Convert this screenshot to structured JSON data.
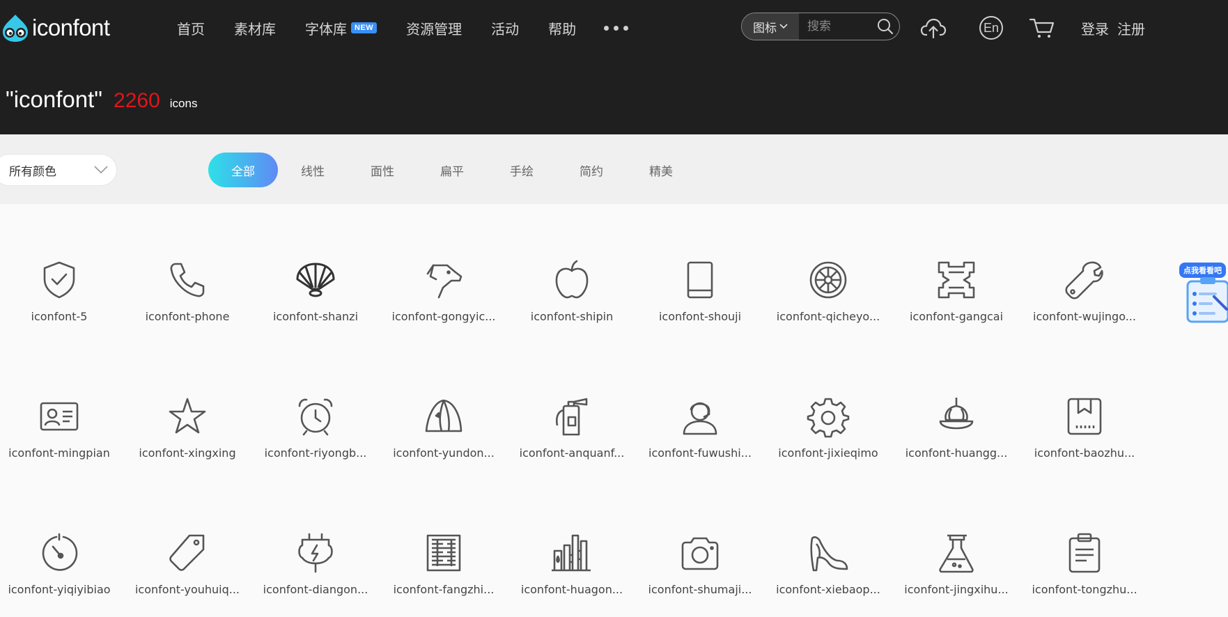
{
  "header": {
    "logo_text": "iconfont",
    "nav": [
      {
        "label": "首页"
      },
      {
        "label": "素材库"
      },
      {
        "label": "字体库",
        "badge": "NEW"
      },
      {
        "label": "资源管理"
      },
      {
        "label": "活动"
      },
      {
        "label": "帮助"
      }
    ],
    "search": {
      "type_label": "图标",
      "placeholder": "搜索"
    },
    "lang_label": "En",
    "login_label": "登录",
    "register_label": "注册"
  },
  "result": {
    "query": "\"iconfont\"",
    "count": "2260",
    "unit": "icons"
  },
  "filter": {
    "color_select": "所有颜色",
    "tabs": [
      "全部",
      "线性",
      "面性",
      "扁平",
      "手绘",
      "简约",
      "精美"
    ],
    "active_tab": "全部"
  },
  "icons": [
    {
      "label": "iconfont-5",
      "icon": "shield-check-icon"
    },
    {
      "label": "iconfont-phone",
      "icon": "phone-icon"
    },
    {
      "label": "iconfont-shanzi",
      "icon": "fan-icon"
    },
    {
      "label": "iconfont-gongyic...",
      "icon": "dog-icon"
    },
    {
      "label": "iconfont-shipin",
      "icon": "apple-icon"
    },
    {
      "label": "iconfont-shouji",
      "icon": "tablet-icon"
    },
    {
      "label": "iconfont-qicheyo...",
      "icon": "wheel-icon"
    },
    {
      "label": "iconfont-gangcai",
      "icon": "steel-icon"
    },
    {
      "label": "iconfont-wujingo...",
      "icon": "wrench-icon"
    },
    {
      "label": "iconfont-mingpian",
      "icon": "id-card-icon"
    },
    {
      "label": "iconfont-xingxing",
      "icon": "star-icon"
    },
    {
      "label": "iconfont-riyongb...",
      "icon": "alarm-clock-icon"
    },
    {
      "label": "iconfont-yundon...",
      "icon": "tent-icon"
    },
    {
      "label": "iconfont-anquanf...",
      "icon": "fire-extinguisher-icon"
    },
    {
      "label": "iconfont-fuwushi...",
      "icon": "headset-user-icon"
    },
    {
      "label": "iconfont-jixieqimo",
      "icon": "gear-icon"
    },
    {
      "label": "iconfont-huangg...",
      "icon": "onion-icon"
    },
    {
      "label": "iconfont-baozhu...",
      "icon": "package-icon"
    },
    {
      "label": "iconfont-yiqiyibiao",
      "icon": "gauge-icon"
    },
    {
      "label": "iconfont-youhuiq...",
      "icon": "tag-icon"
    },
    {
      "label": "iconfont-diangon...",
      "icon": "plug-icon"
    },
    {
      "label": "iconfont-fangzhi...",
      "icon": "textile-icon"
    },
    {
      "label": "iconfont-huagon...",
      "icon": "factory-icon"
    },
    {
      "label": "iconfont-shumaji...",
      "icon": "camera-icon"
    },
    {
      "label": "iconfont-xiebaop...",
      "icon": "high-heel-icon"
    },
    {
      "label": "iconfont-jingxihu...",
      "icon": "flask-icon"
    },
    {
      "label": "iconfont-tongzhu...",
      "icon": "clipboard-icon"
    }
  ],
  "float_widget": {
    "label": "点我看看吧"
  },
  "colors": {
    "accent_red": "#e0151b",
    "tab_gradient_start": "#2ee0e8",
    "tab_gradient_end": "#5f8af5",
    "header_bg": "#1f1f1f"
  }
}
